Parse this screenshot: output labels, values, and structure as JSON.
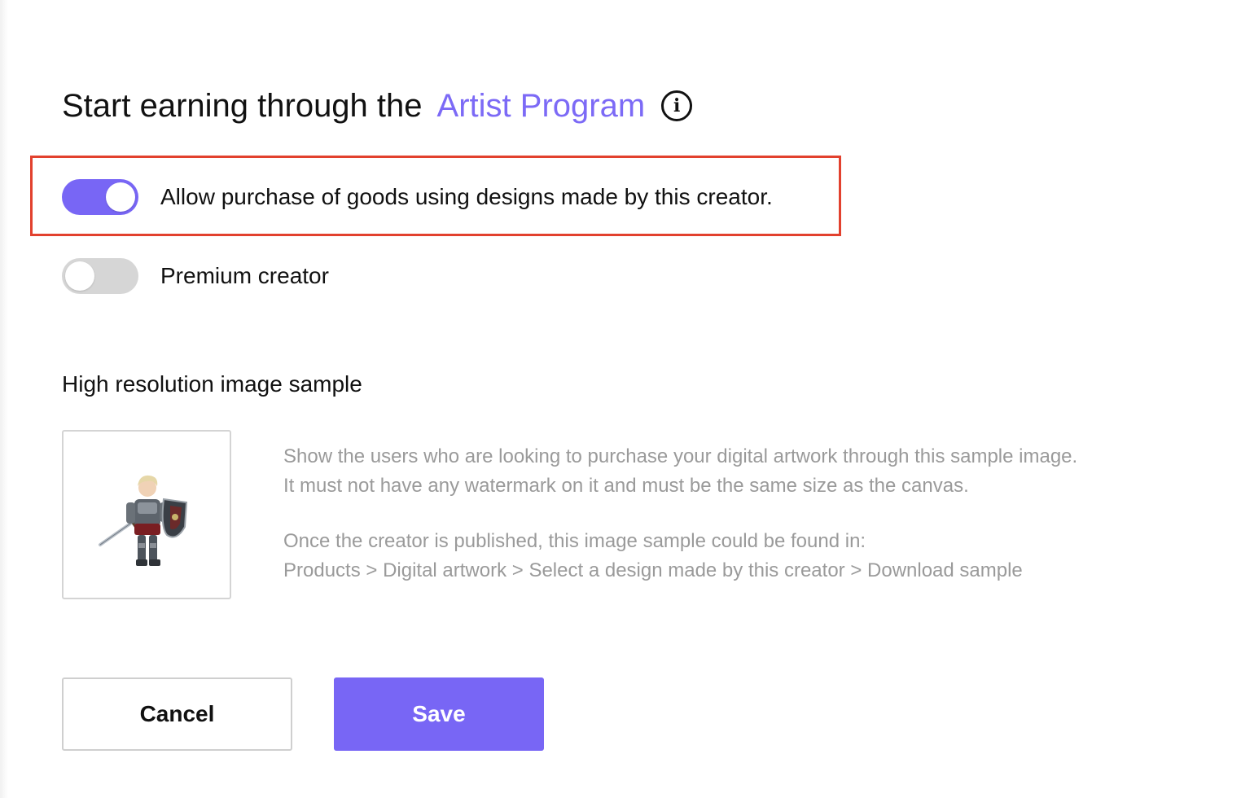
{
  "header": {
    "title_prefix": "Start earning through the",
    "title_link": "Artist Program",
    "info_icon": "info-icon"
  },
  "toggles": [
    {
      "label": "Allow purchase of goods using designs made by this creator.",
      "checked": true
    },
    {
      "label": "Premium creator",
      "checked": false
    }
  ],
  "sample": {
    "heading": "High resolution image sample",
    "image": "armored-knight-with-sword-and-shield",
    "description_lines": [
      "Show the users who are looking to purchase your digital artwork through this sample image.",
      "It must not have any watermark on it and must be the same size as the canvas."
    ],
    "location_lines": [
      "Once the creator is published, this image sample could be found in:",
      "Products > Digital artwork > Select a design made by this creator > Download sample"
    ]
  },
  "actions": {
    "cancel_label": "Cancel",
    "save_label": "Save"
  },
  "colors": {
    "accent": "#7866f5",
    "highlight": "#e2412e",
    "toggle_off": "#d6d6d6",
    "muted_text": "#9a9a9a"
  }
}
